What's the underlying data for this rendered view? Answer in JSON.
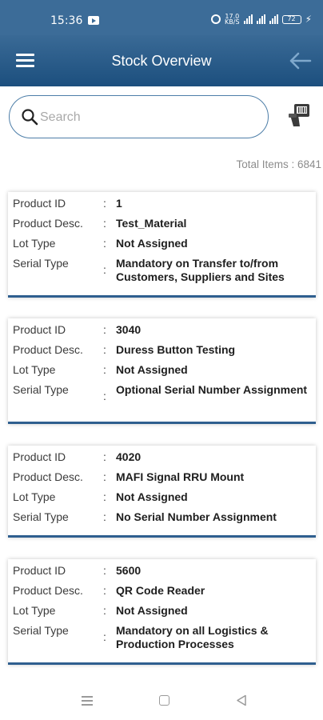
{
  "status_bar": {
    "time": "15:36",
    "net_speed_value": "17.0",
    "net_speed_unit": "KB/S",
    "battery": "72"
  },
  "app_bar": {
    "title": "Stock Overview",
    "menu_icon": "hamburger-menu-icon",
    "back_icon": "arrow-left-icon"
  },
  "search": {
    "placeholder": "Search",
    "value": ""
  },
  "scanner_icon": "barcode-scanner-icon",
  "total_items_text": "Total Items : 6841",
  "products": [
    {
      "fields": [
        {
          "label": "Product ID",
          "value": "1"
        },
        {
          "label": "Product Desc.",
          "value": "Test_Material"
        },
        {
          "label": "Lot Type",
          "value": "Not Assigned"
        },
        {
          "label": "Serial Type",
          "value": "Mandatory on Transfer to/from Customers, Suppliers and Sites"
        }
      ]
    },
    {
      "fields": [
        {
          "label": "Product ID",
          "value": "3040"
        },
        {
          "label": "Product Desc.",
          "value": "Duress Button Testing"
        },
        {
          "label": "Lot Type",
          "value": "Not Assigned"
        },
        {
          "label": "Serial Type",
          "value": "Optional Serial Number Assignment"
        }
      ]
    },
    {
      "fields": [
        {
          "label": "Product ID",
          "value": "4020"
        },
        {
          "label": "Product Desc.",
          "value": "MAFI Signal RRU Mount"
        },
        {
          "label": "Lot Type",
          "value": "Not Assigned"
        },
        {
          "label": "Serial Type",
          "value": "No Serial Number Assignment"
        }
      ]
    },
    {
      "fields": [
        {
          "label": "Product ID",
          "value": "5600"
        },
        {
          "label": "Product Desc.",
          "value": "QR Code Reader"
        },
        {
          "label": "Lot Type",
          "value": "Not Assigned"
        },
        {
          "label": "Serial Type",
          "value": "Mandatory on all Logistics & Production Processes"
        }
      ]
    }
  ],
  "colors": {
    "app_bar": "#1c4f7e",
    "status_bar": "#3c6c98",
    "card_accent": "#2f5f8f",
    "search_border": "#4d7ea8"
  }
}
